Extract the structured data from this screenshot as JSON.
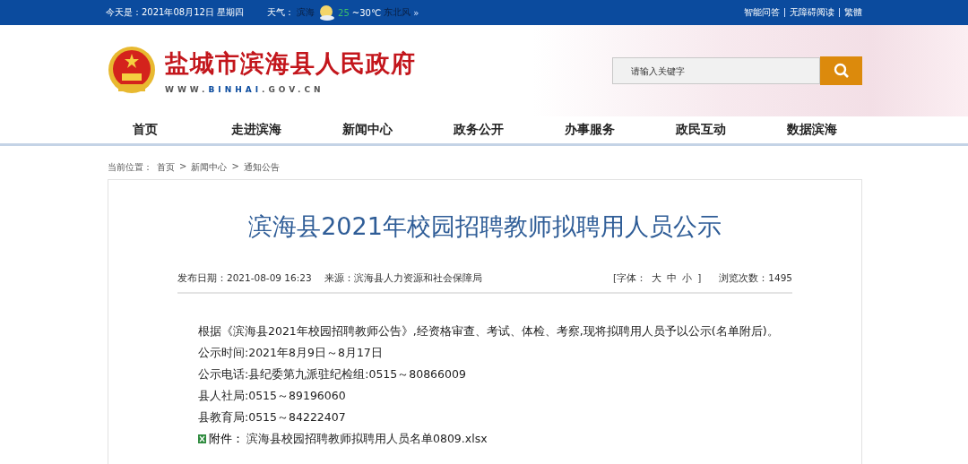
{
  "top_bar": {
    "date_label": "今天是：2021年08月12日 星期四",
    "weather_label": "天气：",
    "weather_city": "滨海",
    "weather_low": "25",
    "weather_high": "~30℃",
    "wind": "东北风",
    "more": "»",
    "links": [
      "智能问答",
      "无障碍阅读",
      "繁體"
    ]
  },
  "header": {
    "site_name": "盐城市滨海县人民政府",
    "domain_prefix": "WWW.",
    "domain_mid": "BINHAI",
    "domain_suffix": ".GOV.CN",
    "search": {
      "placeholder": "请输入关键字"
    }
  },
  "nav": [
    {
      "label": "首页",
      "selected": false
    },
    {
      "label": "走进滨海",
      "selected": false
    },
    {
      "label": "新闻中心",
      "selected": false
    },
    {
      "label": "政务公开",
      "selected": false
    },
    {
      "label": "办事服务",
      "selected": false
    },
    {
      "label": "政民互动",
      "selected": false
    },
    {
      "label": "数据滨海",
      "selected": false
    }
  ],
  "breadcrumb": {
    "label": "当前位置：",
    "items": [
      "首页",
      "新闻中心",
      "通知公告"
    ],
    "separator": ">"
  },
  "article": {
    "title": "滨海县2021年校园招聘教师拟聘用人员公示",
    "publish_date": "发布日期：2021-08-09 16:23",
    "source": "来源：滨海县人力资源和社会保障局",
    "font_label": "[字体：",
    "font_sizes": [
      "大",
      "中",
      "小"
    ],
    "font_close": "]",
    "views": "浏览次数：1495",
    "paragraphs": [
      "根据《滨海县2021年校园招聘教师公告》,经资格审查、考试、体检、考察,现将拟聘用人员予以公示(名单附后)。",
      "公示时间:2021年8月9日～8月17日",
      "公示电话:县纪委第九派驻纪检组:0515～80866009",
      "县人社局:0515～89196060",
      "县教育局:0515～84222407"
    ],
    "attachment": {
      "label": "附件：",
      "file": "滨海县校园招聘教师拟聘用人员名单0809.xlsx"
    }
  }
}
